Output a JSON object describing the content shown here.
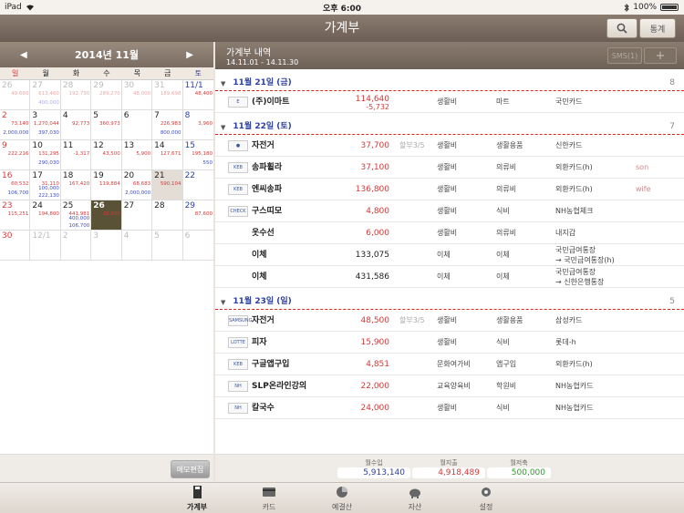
{
  "status": {
    "device": "iPad",
    "time": "오후 6:00",
    "battery": "100%"
  },
  "nav": {
    "title": "가계부",
    "stats": "통계"
  },
  "calendar": {
    "month_label": "2014년 11월",
    "weekdays": [
      "일",
      "월",
      "화",
      "수",
      "목",
      "금",
      "토"
    ],
    "cells": [
      {
        "d": "26",
        "other": true,
        "out": "49,660"
      },
      {
        "d": "27",
        "other": true,
        "out": "613,460",
        "in2": "400,000"
      },
      {
        "d": "28",
        "other": true,
        "out": "192,730"
      },
      {
        "d": "29",
        "other": true,
        "out": "289,270"
      },
      {
        "d": "30",
        "other": true,
        "out": "48,000"
      },
      {
        "d": "31",
        "other": true,
        "out": "189,698"
      },
      {
        "d": "11/1",
        "out": "48,400"
      },
      {
        "d": "2",
        "out": "73,140",
        "in2": "2,000,000"
      },
      {
        "d": "3",
        "out": "1,270,044",
        "in2": "397,030"
      },
      {
        "d": "4",
        "out": "92,773"
      },
      {
        "d": "5",
        "out": "360,973"
      },
      {
        "d": "6"
      },
      {
        "d": "7",
        "out": "226,983",
        "in2": "800,000"
      },
      {
        "d": "8",
        "out": "3,960"
      },
      {
        "d": "9",
        "out": "222,216"
      },
      {
        "d": "10",
        "out": "131,295",
        "in2": "290,030"
      },
      {
        "d": "11",
        "out": "-1,317"
      },
      {
        "d": "12",
        "out": "43,500"
      },
      {
        "d": "13",
        "out": "5,900"
      },
      {
        "d": "14",
        "out": "127,671"
      },
      {
        "d": "15",
        "out": "195,180",
        "in2": "550"
      },
      {
        "d": "16",
        "out": "60,532",
        "in2": "106,700"
      },
      {
        "d": "17",
        "out": "31,110",
        "in2": "100,000",
        "in3": "222,130"
      },
      {
        "d": "18",
        "out": "167,420"
      },
      {
        "d": "19",
        "out": "119,884"
      },
      {
        "d": "20",
        "out": "68,683",
        "in2": "2,000,000"
      },
      {
        "d": "21",
        "hl": true,
        "out": "590,104"
      },
      {
        "d": "22"
      },
      {
        "d": "23",
        "out": "115,251"
      },
      {
        "d": "24",
        "out": "194,800"
      },
      {
        "d": "25",
        "out": "441,981",
        "in2": "400,000",
        "in3": "106,700"
      },
      {
        "d": "26",
        "today": true,
        "out": "18,000"
      },
      {
        "d": "27"
      },
      {
        "d": "28"
      },
      {
        "d": "29",
        "out": "87,600"
      },
      {
        "d": "30"
      },
      {
        "d": "12/1",
        "other": true
      },
      {
        "d": "2",
        "other": true
      },
      {
        "d": "3",
        "other": true
      },
      {
        "d": "4",
        "other": true
      },
      {
        "d": "5",
        "other": true
      },
      {
        "d": "6",
        "other": true
      }
    ],
    "memo_edit": "메모편집"
  },
  "ledger": {
    "title": "가계부 내역",
    "period": "14.11.01 - 14.11.30",
    "sms": "SMS(1)",
    "groups": [
      {
        "date": "11월 21일 (금)",
        "count": "8",
        "rows": [
          {
            "logo": "E",
            "name": "(주)이마트",
            "amount": "114,640",
            "amount2": "-5,732",
            "cat1": "생활비",
            "cat2": "마트",
            "pay": "국민카드"
          }
        ]
      },
      {
        "date": "11월 22일 (토)",
        "count": "7",
        "rows": [
          {
            "logo": "●",
            "name": "자전거",
            "amount": "37,700",
            "inst": "할부3/5",
            "cat1": "생활비",
            "cat2": "생활용품",
            "pay": "신한카드"
          },
          {
            "logo": "KEB",
            "name": "송파휠라",
            "amount": "37,100",
            "cat1": "생활비",
            "cat2": "의류비",
            "pay": "외환카드(h)",
            "memo": "son"
          },
          {
            "logo": "KEB",
            "name": "엔씨송파",
            "amount": "136,800",
            "cat1": "생활비",
            "cat2": "의류비",
            "pay": "외환카드(h)",
            "memo": "wife"
          },
          {
            "logo": "CHECK",
            "name": "구스띠모",
            "amount": "4,800",
            "cat1": "생활비",
            "cat2": "식비",
            "pay": "NH농협체크"
          },
          {
            "logo": "",
            "name": "옷수선",
            "amount": "6,000",
            "cat1": "생활비",
            "cat2": "의류비",
            "pay": "내지갑"
          },
          {
            "logo": "",
            "name": "이체",
            "amount": "133,075",
            "black": true,
            "cat1": "이체",
            "cat2": "이체",
            "pay1": "국민급여통장",
            "pay2": "→ 국민급여통장(h)"
          },
          {
            "logo": "",
            "name": "이체",
            "amount": "431,586",
            "black": true,
            "cat1": "이체",
            "cat2": "이체",
            "pay1": "국민급여통장",
            "pay2": "→ 신한은행통장"
          }
        ]
      },
      {
        "date": "11월 23일 (일)",
        "count": "5",
        "rows": [
          {
            "logo": "SAMSUNG",
            "name": "자전거",
            "amount": "48,500",
            "inst": "할부3/5",
            "cat1": "생활비",
            "cat2": "생활용품",
            "pay": "삼성카드"
          },
          {
            "logo": "LOTTE",
            "name": "피자",
            "amount": "15,900",
            "cat1": "생활비",
            "cat2": "식비",
            "pay": "롯데-h"
          },
          {
            "logo": "KEB",
            "name": "구글앱구입",
            "amount": "4,851",
            "cat1": "문화여가비",
            "cat2": "앱구입",
            "pay": "외환카드(h)"
          },
          {
            "logo": "NH",
            "name": "SLP온라인강의",
            "amount": "22,000",
            "cat1": "교육양육비",
            "cat2": "학원비",
            "pay": "NH농협카드"
          },
          {
            "logo": "NH",
            "name": "칼국수",
            "amount": "24,000",
            "cat1": "생활비",
            "cat2": "식비",
            "pay": "NH농협카드"
          }
        ]
      }
    ],
    "summary": {
      "income_label": "월수입",
      "income": "5,913,140",
      "expense_label": "월지출",
      "expense": "4,918,489",
      "saving_label": "월저축",
      "saving": "500,000"
    }
  },
  "tabs": [
    {
      "label": "가계부",
      "icon": "book-icon",
      "active": true
    },
    {
      "label": "카드",
      "icon": "card-icon"
    },
    {
      "label": "예결산",
      "icon": "pie-chart-icon"
    },
    {
      "label": "자산",
      "icon": "piggy-bank-icon"
    },
    {
      "label": "설정",
      "icon": "gear-icon"
    }
  ]
}
